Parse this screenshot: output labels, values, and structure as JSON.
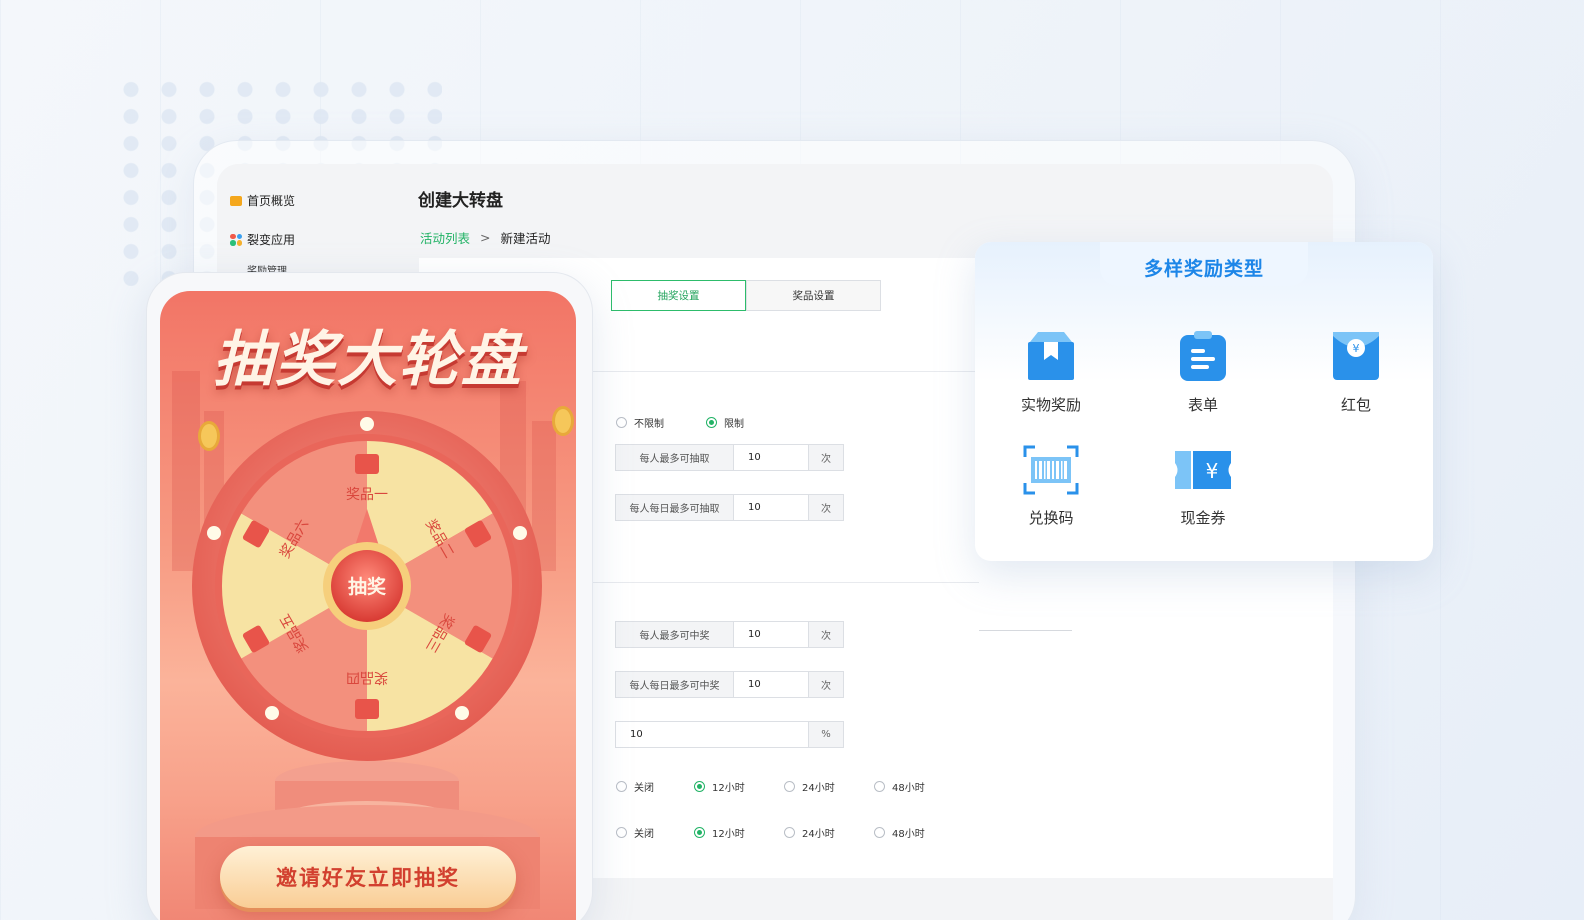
{
  "sidebar": {
    "items": [
      {
        "label": "首页概览",
        "icon": "home-icon"
      },
      {
        "label": "裂变应用",
        "icon": "apps-icon"
      }
    ],
    "sub_items": [
      {
        "label": "奖励管理"
      }
    ]
  },
  "page": {
    "title": "创建大转盘",
    "breadcrumb": {
      "link": "活动列表",
      "separator": ">",
      "current": "新建活动"
    }
  },
  "tabs": [
    {
      "label": "抽奖设置",
      "active": true
    },
    {
      "label": "奖品设置",
      "active": false
    }
  ],
  "form": {
    "limit_options": [
      {
        "label": "不限制",
        "checked": false
      },
      {
        "label": "限制",
        "checked": true
      }
    ],
    "draw_fields": [
      {
        "label": "每人最多可抽取",
        "value": "10",
        "unit": "次"
      },
      {
        "label": "每人每日最多可抽取",
        "value": "10",
        "unit": "次"
      }
    ],
    "win_fields": [
      {
        "label": "每人最多可中奖",
        "value": "10",
        "unit": "次"
      },
      {
        "label": "每人每日最多可中奖",
        "value": "10",
        "unit": "次"
      }
    ],
    "percent_field": {
      "value": "10",
      "unit": "%"
    },
    "time_rows": [
      [
        {
          "label": "关闭",
          "checked": false
        },
        {
          "label": "12小时",
          "checked": true
        },
        {
          "label": "24小时",
          "checked": false
        },
        {
          "label": "48小时",
          "checked": false
        }
      ],
      [
        {
          "label": "关闭",
          "checked": false
        },
        {
          "label": "12小时",
          "checked": true
        },
        {
          "label": "24小时",
          "checked": false
        },
        {
          "label": "48小时",
          "checked": false
        }
      ]
    ]
  },
  "reward_card": {
    "title": "多样奖励类型",
    "items": [
      {
        "label": "实物奖励",
        "icon": "box-icon"
      },
      {
        "label": "表单",
        "icon": "clipboard-icon"
      },
      {
        "label": "红包",
        "icon": "red-envelope-icon"
      },
      {
        "label": "兑换码",
        "icon": "barcode-scan-icon"
      },
      {
        "label": "现金券",
        "icon": "cash-ticket-icon"
      }
    ],
    "accent": "#1d86e8"
  },
  "phone": {
    "title": "抽奖大轮盘",
    "center_button": "抽奖",
    "prizes": [
      "奖品一",
      "奖品二",
      "奖品三",
      "奖品四",
      "奖品五",
      "奖品六"
    ],
    "cta": "邀请好友立即抽奖",
    "colors": {
      "primary": "#f27566",
      "slice_light": "#f7e3a3",
      "slice_dark": "#f18a78"
    }
  }
}
